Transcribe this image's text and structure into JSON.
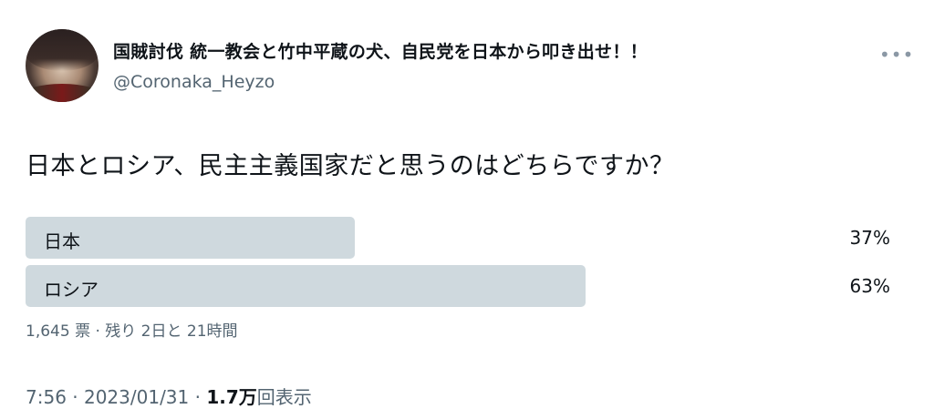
{
  "tweet": {
    "display_name": "国賊討伐 統一教会と竹中平蔵の犬、自民党を日本から叩き出せ！！",
    "handle": "@Coronaka_Heyzo",
    "more_icon": "more-dots-icon",
    "question": "日本とロシア、民主主義国家だと思うのはどちらですか？",
    "poll": {
      "options": [
        {
          "label": "日本",
          "percent_text": "37%",
          "fraction": 0.37
        },
        {
          "label": "ロシア",
          "percent_text": "63%",
          "fraction": 0.63
        }
      ],
      "meta": "1,645 票 · 残り 2日と 21時間"
    },
    "timestamp": {
      "prefix": "7:56 · 2023/01/31 · ",
      "views_number": "1.7万",
      "views_suffix": "回表示"
    }
  },
  "colors": {
    "bar": "#cfd9de",
    "text": "#0f1419",
    "secondary_text": "#536471"
  }
}
